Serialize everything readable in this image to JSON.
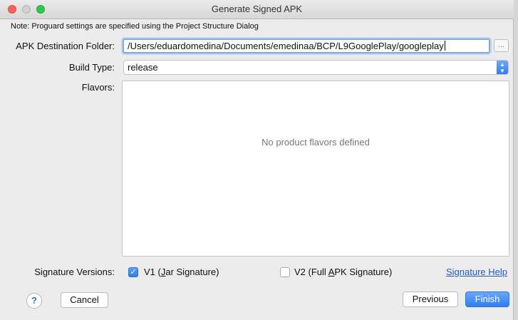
{
  "window": {
    "title": "Generate Signed APK"
  },
  "note": "Note: Proguard settings are specified using the Project Structure Dialog",
  "destination": {
    "label": "APK Destination Folder:",
    "value": "/Users/eduardomedina/Documents/emedinaa/BCP/L9GooglePlay/googleplay",
    "browse_label": "..."
  },
  "build_type": {
    "label": "Build Type:",
    "selected": "release"
  },
  "flavors": {
    "label": "Flavors:",
    "empty_text": "No product flavors defined"
  },
  "signature": {
    "label": "Signature Versions:",
    "v1": {
      "prefix": "V1 (",
      "mnemonic": "J",
      "suffix": "ar Signature)",
      "checked": true
    },
    "v2": {
      "prefix": "V2 (Full ",
      "mnemonic": "A",
      "suffix": "PK Signature)",
      "checked": false
    },
    "help_link": "Signature Help"
  },
  "buttons": {
    "help": "?",
    "cancel": "Cancel",
    "previous": "Previous",
    "finish": "Finish"
  },
  "colors": {
    "accent": "#2d7ff2",
    "link": "#2559c9",
    "close": "#fc605c",
    "maximize": "#34c84a"
  }
}
